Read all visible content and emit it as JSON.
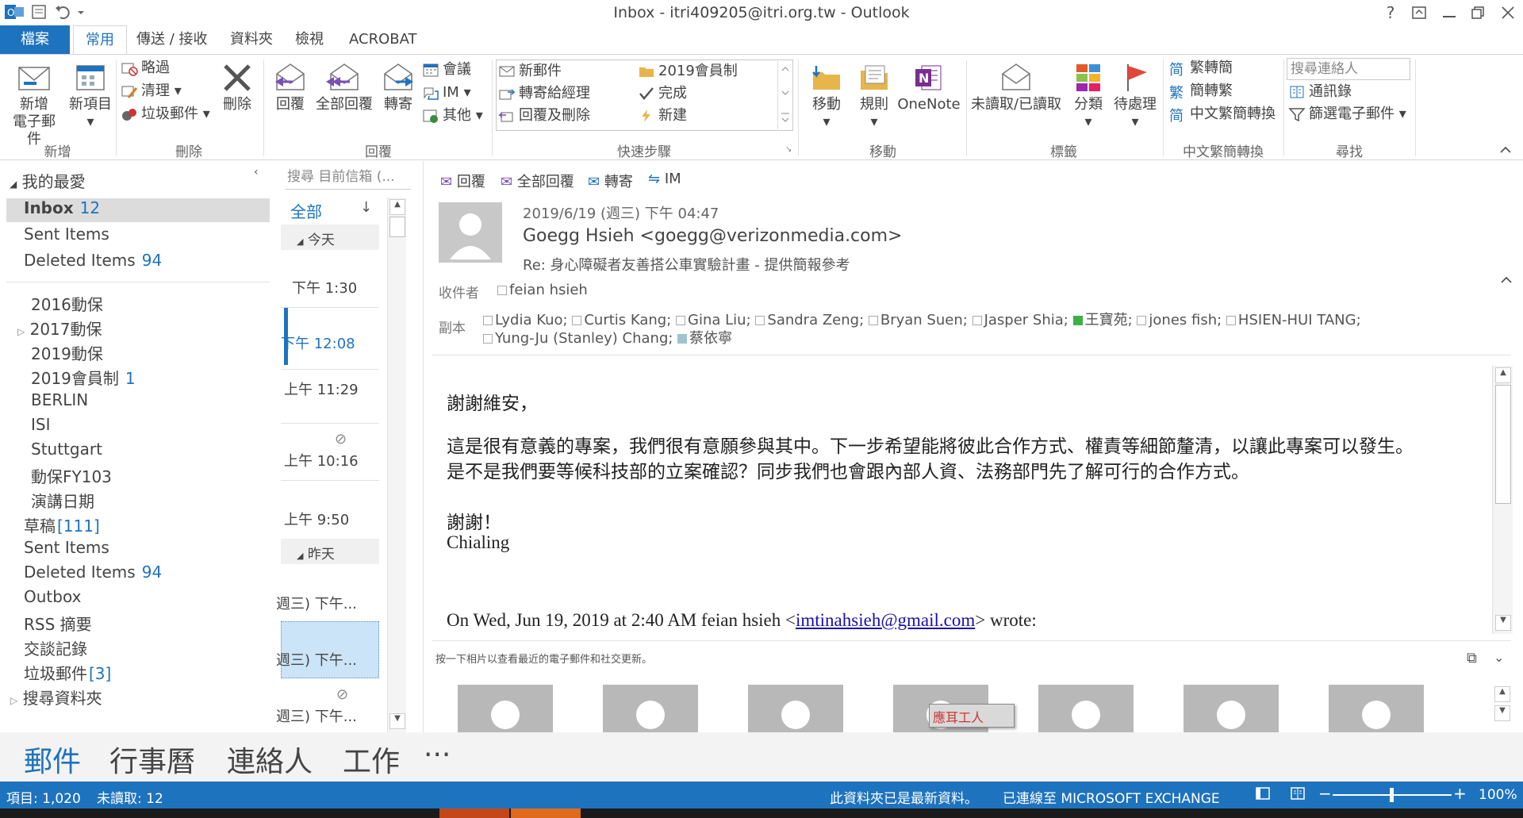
{
  "window": {
    "title": "Inbox - itri409205@itri.org.tw - Outlook",
    "help": "?"
  },
  "tabs": {
    "file": "檔案",
    "home": "常用",
    "send_receive": "傳送 / 接收",
    "folder": "資料夾",
    "view": "檢視",
    "acrobat": "ACROBAT"
  },
  "ribbon": {
    "new_group": "新增",
    "new_email_l1": "新增",
    "new_email_l2": "電子郵件",
    "new_items": "新項目",
    "delete_group": "刪除",
    "ignore": "略過",
    "cleanup": "清理",
    "junk": "垃圾郵件",
    "delete": "刪除",
    "respond_group": "回覆",
    "reply": "回覆",
    "reply_all": "全部回覆",
    "forward": "轉寄",
    "meeting": "會議",
    "im": "IM",
    "more": "其他",
    "quicksteps_group": "快速步驟",
    "qs_new_email": "新郵件",
    "qs_forward_mgr": "轉寄給經理",
    "qs_reply_delete": "回覆及刪除",
    "qs_2019": "2019會員制",
    "qs_done": "完成",
    "qs_create": "新建",
    "move_group": "移動",
    "move": "移動",
    "rules": "規則",
    "onenote": "OneNote",
    "tags_group": "標籤",
    "unread_read": "未讀取/已讀取",
    "categorize": "分類",
    "followup": "待處理",
    "chinese_group": "中文繁簡轉換",
    "trad_to_simp": "繁轉簡",
    "simp_to_trad": "簡轉繁",
    "chinese_conv": "中文繁簡轉換",
    "find_group": "尋找",
    "search_contacts_placeholder": "搜尋連絡人",
    "address_book": "通訊錄",
    "filter_email": "篩選電子郵件"
  },
  "folders": {
    "favorites_header": "我的最愛",
    "favorites": [
      {
        "name": "Inbox",
        "count": "12"
      },
      {
        "name": "Sent Items",
        "count": ""
      },
      {
        "name": "Deleted Items",
        "count": "94"
      }
    ],
    "folders": [
      {
        "name": "2016動保",
        "count": ""
      },
      {
        "name": "2017動保",
        "count": ""
      },
      {
        "name": "2019動保",
        "count": ""
      },
      {
        "name": "2019會員制",
        "count": "1"
      },
      {
        "name": "BERLIN",
        "count": ""
      },
      {
        "name": "ISI",
        "count": ""
      },
      {
        "name": "Stuttgart",
        "count": ""
      },
      {
        "name": "動保FY103",
        "count": ""
      },
      {
        "name": "演講日期",
        "count": ""
      }
    ],
    "mailbox": [
      {
        "name": "草稿",
        "count": "[111]"
      },
      {
        "name": "Sent Items",
        "count": ""
      },
      {
        "name": "Deleted Items",
        "count": "94"
      },
      {
        "name": "Outbox",
        "count": ""
      },
      {
        "name": "RSS 摘要",
        "count": ""
      },
      {
        "name": "交談記錄",
        "count": ""
      },
      {
        "name": "垃圾郵件",
        "count": "[3]"
      },
      {
        "name": "搜尋資料夾",
        "count": ""
      }
    ]
  },
  "message_list": {
    "search_placeholder": "搜尋 目前信箱 (...",
    "all": "全部",
    "today": "今天",
    "yesterday": "昨天",
    "times": [
      "下午 1:30",
      "下午 12:08",
      "上午 11:29",
      "上午 10:16",
      "上午 9:50"
    ],
    "y_items": [
      "週三) 下午...",
      "週三) 下午...",
      "週三) 下午..."
    ]
  },
  "reading": {
    "reply": "回覆",
    "reply_all": "全部回覆",
    "forward": "轉寄",
    "im": "IM",
    "date": "2019/6/19 (週三) 下午 04:47",
    "from": "Goegg Hsieh <goegg@verizonmedia.com>",
    "subject": "Re: 身心障礙者友善搭公車實驗計畫 - 提供簡報參考",
    "to_label": "收件者",
    "to": "feian hsieh",
    "cc_label": "副本",
    "cc_line1": [
      "Lydia Kuo;",
      "Curtis Kang;",
      "Gina Liu;",
      "Sandra Zeng;",
      "Bryan Suen;",
      "Jasper Shia;",
      "王寶苑;",
      "jones fish;",
      "HSIEN-HUI TANG;"
    ],
    "cc_line2": [
      "Yung-Ju (Stanley) Chang;",
      "蔡依寧"
    ],
    "body": {
      "greeting": "謝謝維安，",
      "p1": "這是很有意義的專案，我們很有意願參與其中。下一步希望能將彼此合作方式、權責等細節釐清，以讓此專案可以發生。",
      "p2": "是不是我們要等候科技部的立案確認？同步我們也會跟內部人資、法務部門先了解可行的合作方式。",
      "thanks": "謝謝！",
      "signature": "Chialing",
      "quote_prefix": "On Wed, Jun 19, 2019 at 2:40 AM feian hsieh <",
      "quote_email": "imtinahsieh@gmail.com",
      "quote_suffix": "> wrote:"
    },
    "people_hint": "按一下相片以查看最近的電子郵件和社交更新。",
    "photo_tooltip": "應耳工人"
  },
  "nav": {
    "mail": "郵件",
    "calendar": "行事曆",
    "people": "連絡人",
    "tasks": "工作",
    "more": "···"
  },
  "status": {
    "items": "項目: 1,020",
    "unread": "未讀取: 12",
    "up_to_date": "此資料夾已是最新資料。",
    "connected": "已連線至 MICROSOFT EXCHANGE",
    "zoom": "100%"
  },
  "colors": {
    "accent": "#1e73be",
    "selection": "#cce4f7",
    "link": "#1a0dab"
  }
}
